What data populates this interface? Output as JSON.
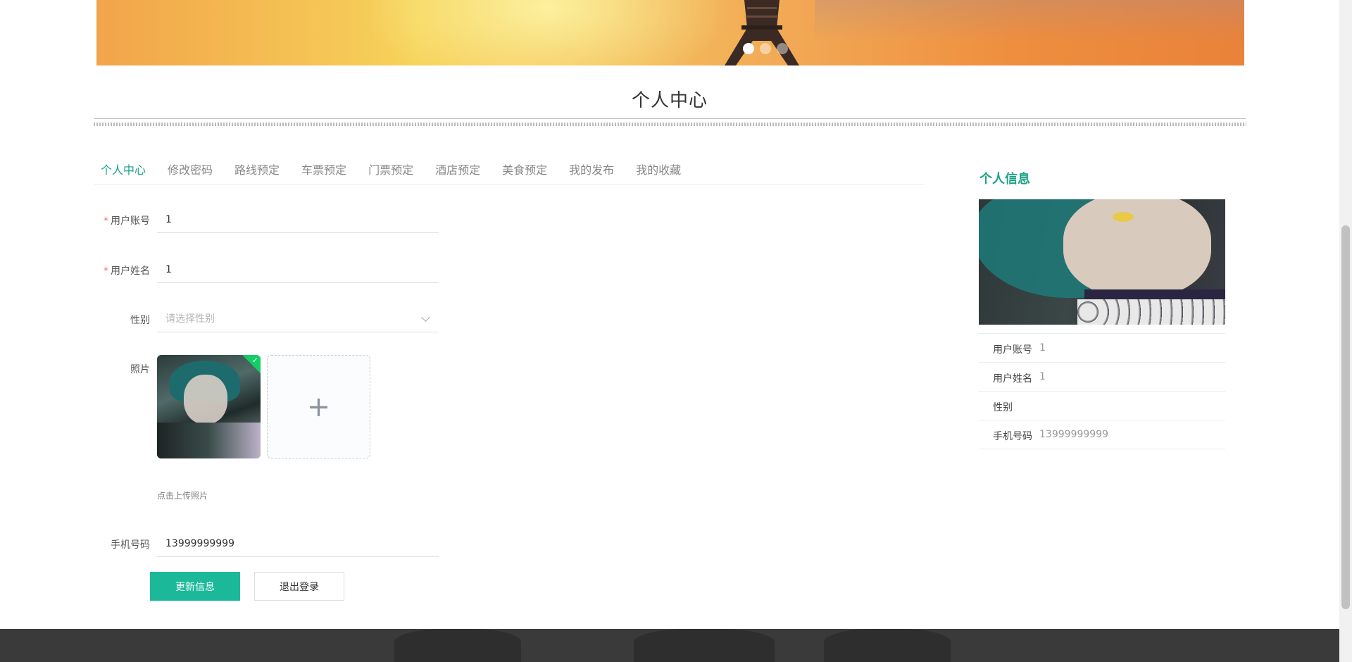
{
  "banner": {
    "carousel_total": 3,
    "carousel_active_index": 1
  },
  "page_title": "个人中心",
  "tabs": [
    {
      "label": "个人中心",
      "active": true
    },
    {
      "label": "修改密码",
      "active": false
    },
    {
      "label": "路线预定",
      "active": false
    },
    {
      "label": "车票预定",
      "active": false
    },
    {
      "label": "门票预定",
      "active": false
    },
    {
      "label": "酒店预定",
      "active": false
    },
    {
      "label": "美食预定",
      "active": false
    },
    {
      "label": "我的发布",
      "active": false
    },
    {
      "label": "我的收藏",
      "active": false
    }
  ],
  "form": {
    "account": {
      "label": "用户账号",
      "value": "1",
      "required": true
    },
    "name": {
      "label": "用户姓名",
      "value": "1",
      "required": true
    },
    "gender": {
      "label": "性别",
      "placeholder": "请选择性别",
      "value": ""
    },
    "photo": {
      "label": "照片",
      "tip": "点击上传照片"
    },
    "phone": {
      "label": "手机号码",
      "value": "13999999999"
    },
    "update_button": "更新信息",
    "logout_button": "退出登录"
  },
  "side": {
    "title": "个人信息",
    "rows": [
      {
        "label": "用户账号",
        "value": "1"
      },
      {
        "label": "用户姓名",
        "value": "1"
      },
      {
        "label": "性别",
        "value": ""
      },
      {
        "label": "手机号码",
        "value": "13999999999"
      }
    ]
  },
  "colors": {
    "accent": "#1aa289",
    "button_primary": "#1bb99a",
    "required": "#f56c6c",
    "footer": "#3a3a3a"
  },
  "icons": {
    "upload": "plus-icon",
    "select": "chevron-down-icon",
    "uploaded": "check-icon"
  }
}
